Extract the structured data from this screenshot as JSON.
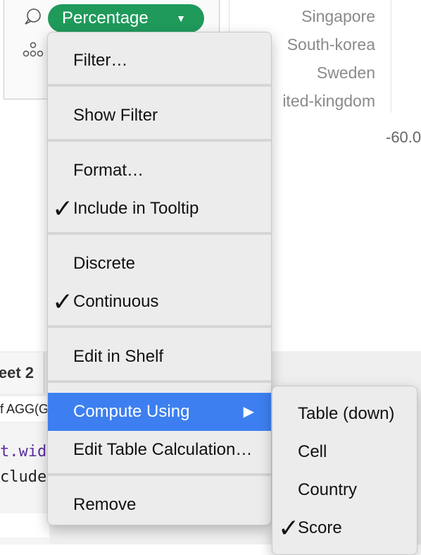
{
  "marks_card": {
    "pill_label": "Percentage",
    "pill_caret": "▼"
  },
  "view": {
    "countries": [
      "Singapore",
      "South-korea",
      "Sweden",
      "ited-kingdom"
    ],
    "axis_tick": "-60.0"
  },
  "sheet_tab": {
    "label": "eet 2"
  },
  "status": {
    "text": "f AGG(G"
  },
  "code_lines": [
    "t.wid",
    "clude"
  ],
  "menu": {
    "items": [
      {
        "label": "Filter…",
        "checked": false
      },
      {
        "label": "Show Filter",
        "checked": false
      },
      {
        "label": "Format…",
        "checked": false
      },
      {
        "label": "Include in Tooltip",
        "checked": true
      },
      {
        "label": "Discrete",
        "checked": false
      },
      {
        "label": "Continuous",
        "checked": true
      },
      {
        "label": "Edit in Shelf",
        "checked": false
      },
      {
        "label": "Compute Using",
        "checked": false,
        "submenu": true
      },
      {
        "label": "Edit Table Calculation…",
        "checked": false
      },
      {
        "label": "Remove",
        "checked": false
      }
    ],
    "check_glyph": "✓",
    "submenu_arrow": "▶"
  },
  "submenu": {
    "items": [
      {
        "label": "Table (down)",
        "checked": false
      },
      {
        "label": "Cell",
        "checked": false
      },
      {
        "label": "Country",
        "checked": false
      },
      {
        "label": "Score",
        "checked": true
      }
    ]
  },
  "colors": {
    "pill": "#1f9a5b",
    "highlight": "#3d7ff0",
    "code_purple": "#5a2ca0"
  },
  "icons": [
    "detail-icon",
    "tooltip-icon",
    "checkmark-icon",
    "submenu-arrow-icon",
    "dropdown-caret-icon"
  ]
}
